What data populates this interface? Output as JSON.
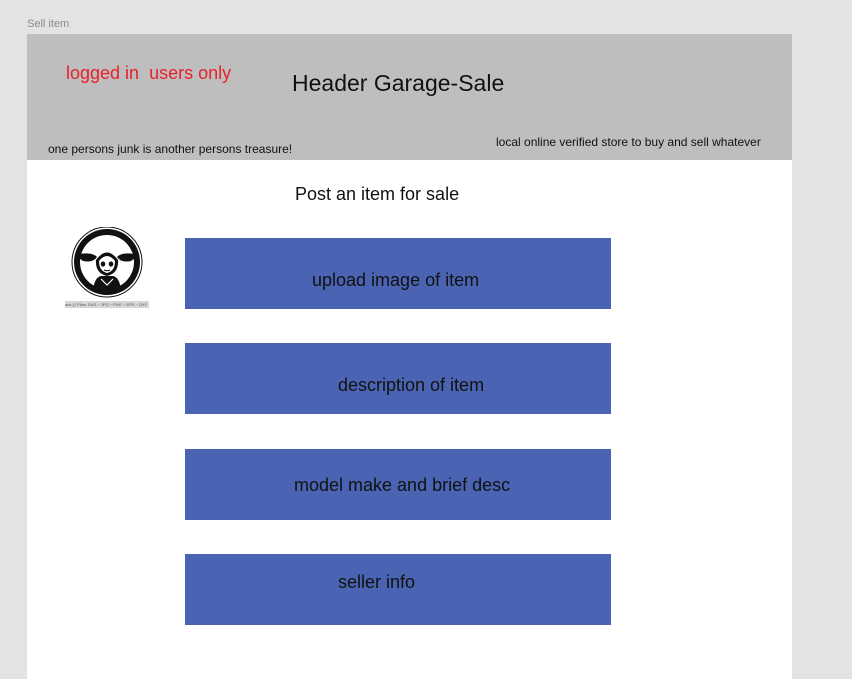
{
  "frame": {
    "label": "Sell item"
  },
  "header": {
    "login_note": "logged in  users only",
    "title": "Header Garage-Sale",
    "tagline_left": "one persons junk is another persons treasure!",
    "tagline_right": "local online verified store to buy and sell whatever",
    "background_color": "#bebebe",
    "login_note_color": "#e8202a"
  },
  "main": {
    "heading": "Post an item for sale",
    "thumbnail": {
      "icon": "baby-yoda-logo-icon",
      "caption": "ave (1 Files: SVG ~ JPG ~ PNG ~ EPS ~ DXF"
    },
    "buttons": {
      "upload_image": "upload image of item",
      "description": "description of item",
      "model_make": "model make and brief desc",
      "seller_info": "seller info"
    },
    "button_color": "#4a64b3"
  }
}
